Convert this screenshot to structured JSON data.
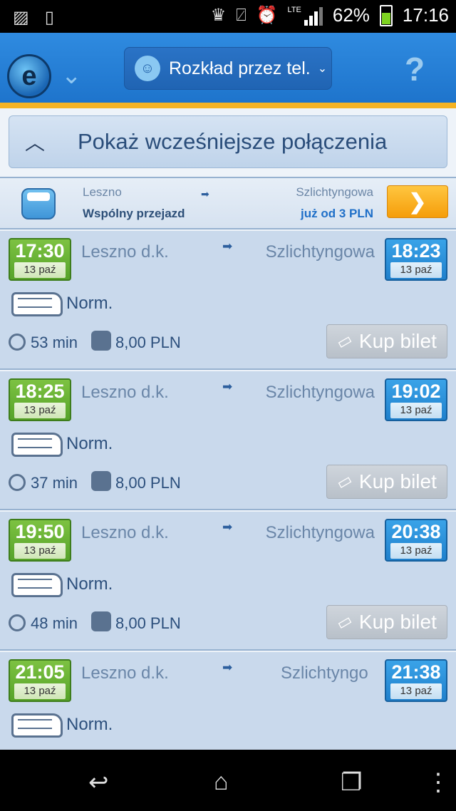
{
  "statusbar": {
    "lte": "LTE",
    "battery": "62%",
    "time": "17:16",
    "icons": [
      "gallery-icon",
      "phone-icon",
      "trophy-icon",
      "vibrate-icon",
      "alarm-icon",
      "signal-icon",
      "battery-icon"
    ]
  },
  "header": {
    "mode_label": "Rozkład przez tel.",
    "help": "?"
  },
  "earlier": {
    "label": "Pokaż wcześniejsze połączenia"
  },
  "ride_share": {
    "from": "Leszno",
    "label": "Wspólny przejazd",
    "to": "Szlichtyngowa",
    "price": "już od 3 PLN"
  },
  "connections": [
    {
      "dep_time": "17:30",
      "dep_date": "13 paź",
      "from": "Leszno d.k.",
      "to": "Szlichtyngowa",
      "arr_time": "18:23",
      "arr_date": "13 paź",
      "type": "Norm.",
      "duration": "53 min",
      "price": "8,00 PLN",
      "buy_label": "Kup bilet"
    },
    {
      "dep_time": "18:25",
      "dep_date": "13 paź",
      "from": "Leszno d.k.",
      "to": "Szlichtyngowa",
      "arr_time": "19:02",
      "arr_date": "13 paź",
      "type": "Norm.",
      "duration": "37 min",
      "price": "8,00 PLN",
      "buy_label": "Kup bilet"
    },
    {
      "dep_time": "19:50",
      "dep_date": "13 paź",
      "from": "Leszno d.k.",
      "to": "Szlichtyngowa",
      "arr_time": "20:38",
      "arr_date": "13 paź",
      "type": "Norm.",
      "duration": "48 min",
      "price": "8,00 PLN",
      "buy_label": "Kup bilet"
    },
    {
      "dep_time": "21:05",
      "dep_date": "13 paź",
      "from": "Leszno d.k.",
      "to": "Szlichtyngo",
      "arr_time": "21:38",
      "arr_date": "13 paź",
      "type": "Norm."
    }
  ],
  "colors": {
    "header_blue": "#1e74cc",
    "accent_orange": "#f5b324",
    "departure_green": "#56a32a",
    "arrival_blue": "#1f80cc"
  }
}
